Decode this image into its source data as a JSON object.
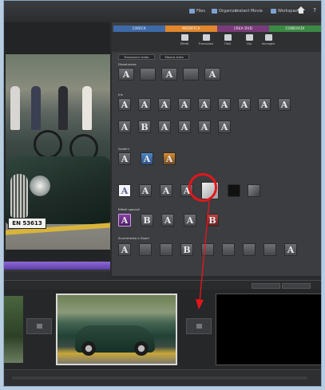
{
  "topbar": {
    "menu": [
      {
        "label": "Files"
      },
      {
        "label": "Organizer"
      },
      {
        "label": "Instant Movie"
      },
      {
        "label": "Workspace"
      }
    ],
    "home_icon": "home-icon",
    "help_icon": "help-icon"
  },
  "panel": {
    "tabs": [
      {
        "label": "CARICA",
        "color": "#3f6aa8"
      },
      {
        "label": "MODIFICA",
        "color": "#e0862c"
      },
      {
        "label": "CREA DVD",
        "color": "#7a3b7a"
      },
      {
        "label": "CONDIVIDI",
        "color": "#3b8a44"
      }
    ],
    "subbar": [
      {
        "label": "Effetti",
        "icon": "effects-icon"
      },
      {
        "label": "Transizioni",
        "icon": "transitions-icon"
      },
      {
        "label": "Titoli",
        "icon": "titles-icon"
      },
      {
        "label": "Clip",
        "icon": "clip-icon"
      },
      {
        "label": "Immagini",
        "icon": "images-icon"
      }
    ],
    "filter": {
      "left": "Transizioni video",
      "right": "Mostra tutto"
    },
    "sections": [
      {
        "label": "Dissolvenza"
      },
      {
        "label": "Iris"
      },
      {
        "label": "Gradini"
      },
      {
        "label": "Pagina"
      },
      {
        "label": "Effetti speciali"
      },
      {
        "label": "Scorrimento e Zoom"
      }
    ],
    "tile_letter": "A",
    "tile_letter_b": "B"
  },
  "preview": {
    "plate": "EN 53613"
  },
  "timeline": {
    "left_label": "◀",
    "right_label": "▶"
  }
}
